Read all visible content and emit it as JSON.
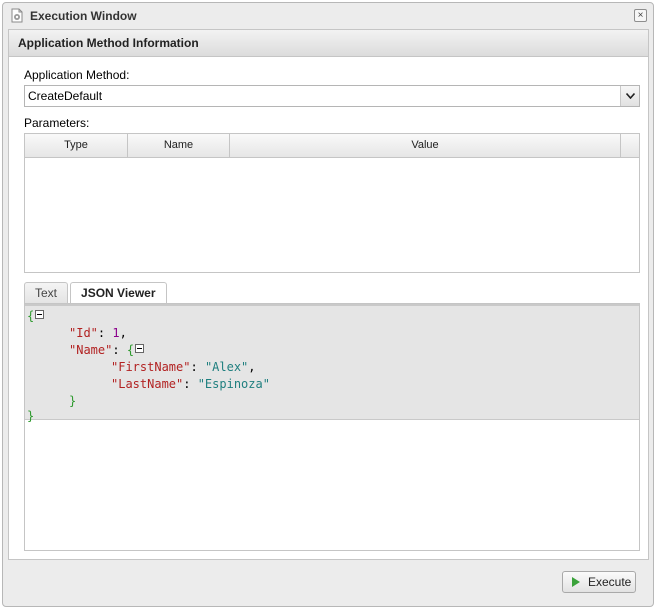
{
  "window": {
    "title": "Execution Window",
    "close_symbol": "×"
  },
  "panel": {
    "header": "Application Method Information"
  },
  "method": {
    "label": "Application Method:",
    "selected": "CreateDefault"
  },
  "parameters": {
    "label": "Parameters:",
    "columns": [
      "Type",
      "Name",
      "Value"
    ],
    "rows": []
  },
  "tabs": [
    {
      "label": "Text",
      "active": false
    },
    {
      "label": "JSON Viewer",
      "active": true
    }
  ],
  "json_viewer": {
    "open_brace": "{",
    "close_brace": "}",
    "id_key": "\"Id\"",
    "id_value": "1",
    "name_key": "\"Name\"",
    "firstname_key": "\"FirstName\"",
    "firstname_value": "\"Alex\"",
    "lastname_key": "\"LastName\"",
    "lastname_value": "\"Espinoza\""
  },
  "actions": {
    "execute_label": "Execute"
  },
  "icons": {
    "app": "app-gear-icon",
    "close": "close-icon",
    "dropdown": "chevron-down-icon",
    "execute": "play-icon",
    "collapse": "collapse-toggle-icon"
  },
  "colors": {
    "json_brace": "#2e9a2e",
    "json_key": "#b22222",
    "json_number": "#8b008b",
    "json_string": "#1f7f7f",
    "play_green": "#3aa23a"
  }
}
